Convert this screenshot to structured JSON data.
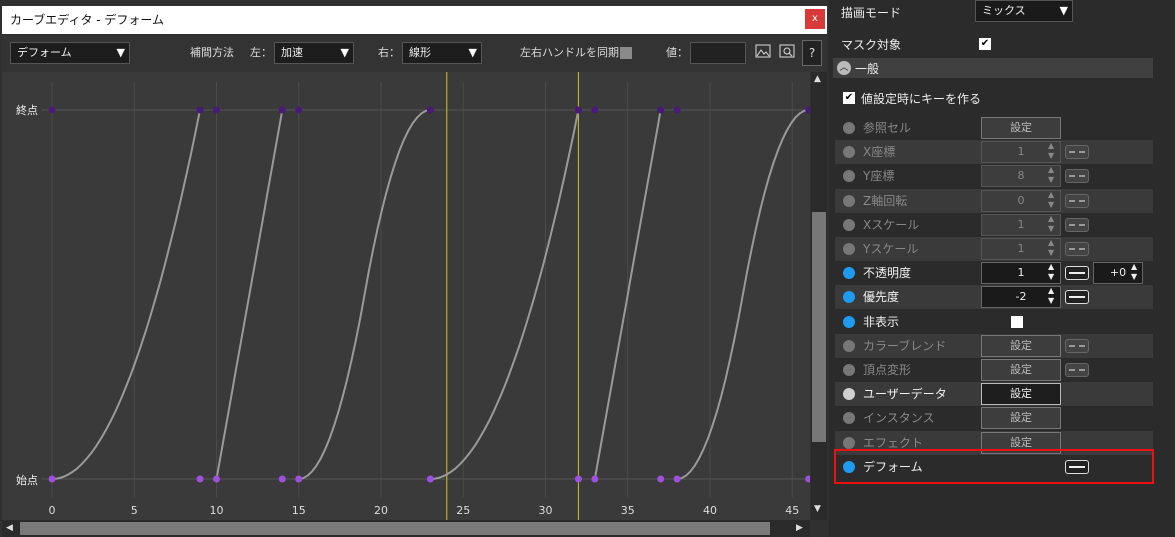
{
  "editor": {
    "title": "カーブエディタ - デフォーム",
    "close_label": "x",
    "toolbar": {
      "target_select": "デフォーム",
      "interp_label": "補間方法",
      "left_label": "左：",
      "left_select": "加速",
      "right_label": "右：",
      "right_select": "線形",
      "sync_label": "左右ハンドルを同期：",
      "value_label": "値：",
      "value_input": "",
      "help_label": "?"
    },
    "graph": {
      "y_label_top": "終点",
      "y_label_bottom": "始点",
      "x_ticks": [
        "0",
        "5",
        "10",
        "15",
        "20",
        "25",
        "30",
        "35",
        "40",
        "45"
      ]
    }
  },
  "chart_data": {
    "type": "line",
    "xlim": [
      0,
      46
    ],
    "ylim": [
      0,
      1
    ],
    "y_labels": [
      "始点",
      "終点"
    ],
    "x_ticks": [
      0,
      5,
      10,
      15,
      20,
      25,
      30,
      35,
      40,
      45
    ],
    "keys_start": [
      0,
      9,
      10,
      14,
      15,
      23,
      32,
      33,
      37,
      38,
      46
    ],
    "keys_end": [
      0,
      9,
      10,
      14,
      15,
      23,
      32,
      33,
      37,
      38,
      46
    ],
    "segments": [
      {
        "x0": 0,
        "x1": 9,
        "type": "ease-in"
      },
      {
        "x0": 10,
        "x1": 14,
        "type": "linear"
      },
      {
        "x0": 15,
        "x1": 23,
        "type": "ease-in-out"
      },
      {
        "x0": 23,
        "x1": 32,
        "type": "ease-in"
      },
      {
        "x0": 33,
        "x1": 37,
        "type": "linear"
      },
      {
        "x0": 38,
        "x1": 46,
        "type": "ease-in-out"
      }
    ],
    "cursor_x": [
      24,
      32
    ],
    "grid": true
  },
  "props": {
    "draw_mode_label": "描画モード",
    "draw_mode_value": "ミックス",
    "mask_label": "マスク対象",
    "section_label": "一般",
    "key_on_set_label": "値設定時にキーを作る",
    "rows": [
      {
        "label": "参照セル",
        "kind": "button",
        "value": "設定"
      },
      {
        "label": "X座標",
        "kind": "number",
        "value": "1"
      },
      {
        "label": "Y座標",
        "kind": "number",
        "value": "8"
      },
      {
        "label": "Z軸回転",
        "kind": "number",
        "value": "0"
      },
      {
        "label": "Xスケール",
        "kind": "number",
        "value": "1"
      },
      {
        "label": "Yスケール",
        "kind": "number",
        "value": "1"
      },
      {
        "label": "不透明度",
        "kind": "number",
        "value": "1"
      },
      {
        "label": "優先度",
        "kind": "number",
        "value": "-2"
      },
      {
        "label": "非表示",
        "kind": "check",
        "value": ""
      },
      {
        "label": "カラーブレンド",
        "kind": "button",
        "value": "設定"
      },
      {
        "label": "頂点変形",
        "kind": "button",
        "value": "設定"
      },
      {
        "label": "ユーザーデータ",
        "kind": "button",
        "value": "設定"
      },
      {
        "label": "インスタンス",
        "kind": "button",
        "value": "設定"
      },
      {
        "label": "エフェクト",
        "kind": "button",
        "value": "設定"
      },
      {
        "label": "デフォーム",
        "kind": "link",
        "value": ""
      }
    ],
    "opacity_offset": "+0"
  },
  "colors": {
    "accent": "#1e9bf0",
    "key_point": "#a050e0",
    "curve": "#9a9a9a",
    "cursor": "#d8c020",
    "highlight": "#ee1111"
  }
}
